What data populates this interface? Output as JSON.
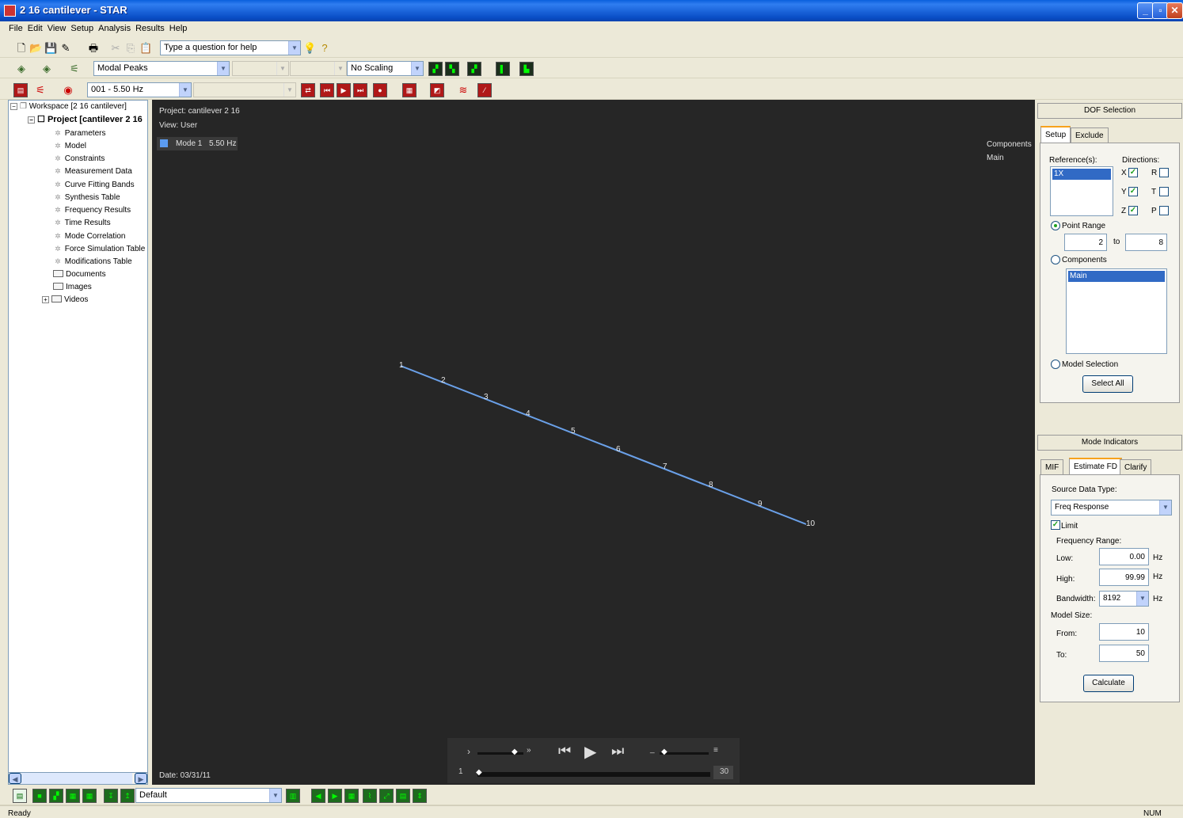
{
  "window": {
    "title": "2 16 cantilever - STAR"
  },
  "menu": [
    "File",
    "Edit",
    "View",
    "Setup",
    "Analysis",
    "Results",
    "Help"
  ],
  "toolbar1": {
    "help_placeholder": "Type a question for help"
  },
  "toolbar2": {
    "display_select": "Modal Peaks",
    "scaling_select": "No Scaling"
  },
  "toolbar3": {
    "mode_select": "001 - 5.50 Hz"
  },
  "tree": {
    "workspace": "Workspace [2 16 cantilever]",
    "project": "Project [cantilever 2 16",
    "items": [
      "Parameters",
      "Model",
      "Constraints",
      "Measurement Data",
      "Curve Fitting Bands",
      "Synthesis Table",
      "Frequency Results",
      "Time Results",
      "Mode Correlation",
      "Force Simulation Table",
      "Modifications Table"
    ],
    "folders": [
      "Documents",
      "Images",
      "Videos"
    ]
  },
  "view": {
    "project": "Project: cantilever 2 16",
    "view_name": "View: User",
    "mode_label": "Mode 1",
    "mode_freq": "5.50 Hz",
    "components_title": "Components",
    "components_item": "Main",
    "date": "Date: 03/31/11",
    "points": [
      "1",
      "2",
      "3",
      "4",
      "5",
      "6",
      "7",
      "8",
      "9",
      "10"
    ],
    "line_color": "#6aa0e8",
    "player": {
      "frame_start": "1",
      "frame_end": "30"
    }
  },
  "dof": {
    "title": "DOF Selection",
    "tabs": [
      "Setup",
      "Exclude"
    ],
    "references_label": "Reference(s):",
    "directions_label": "Directions:",
    "reference_item": "1X",
    "dirs": [
      {
        "name": "X",
        "checked": true
      },
      {
        "name": "Y",
        "checked": true
      },
      {
        "name": "Z",
        "checked": true
      },
      {
        "name": "R",
        "checked": false
      },
      {
        "name": "T",
        "checked": false
      },
      {
        "name": "P",
        "checked": false
      }
    ],
    "point_range_label": "Point Range",
    "range_from": "2",
    "to_label": "to",
    "range_to": "8",
    "components_label": "Components",
    "component_item": "Main",
    "model_selection_label": "Model Selection",
    "select_all": "Select All"
  },
  "mode_ind": {
    "title": "Mode Indicators",
    "tabs": [
      "MIF",
      "Estimate FD",
      "Clarify"
    ],
    "source_label": "Source Data Type:",
    "source_value": "Freq Response",
    "limit_label": "Limit",
    "freq_range_label": "Frequency Range:",
    "low_label": "Low:",
    "low_value": "0.00",
    "high_label": "High:",
    "high_value": "99.99",
    "bandwidth_label": "Bandwidth:",
    "bandwidth_value": "8192",
    "hz": "Hz",
    "model_size_label": "Model Size:",
    "from_label": "From:",
    "from_value": "10",
    "to_label": "To:",
    "to_value": "50",
    "calculate": "Calculate"
  },
  "bottom_toolbar": {
    "layout_select": "Default"
  },
  "status": {
    "left": "Ready",
    "right": "NUM"
  }
}
